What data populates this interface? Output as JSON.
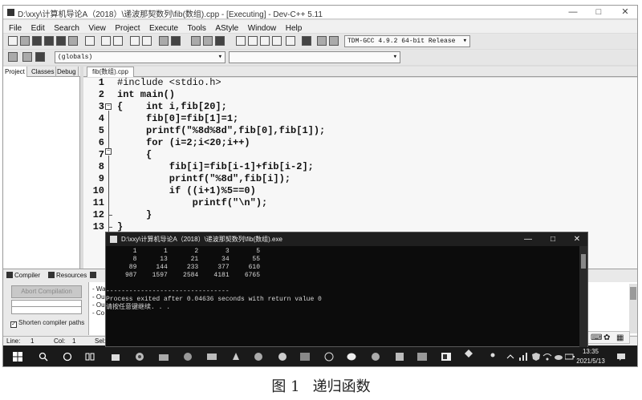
{
  "window": {
    "title": "D:\\xxy\\计算机导论A（2018）\\递波那契数列\\fib(数组).cpp - [Executing] - Dev-C++ 5.11",
    "controls": [
      "—",
      "□",
      "✕"
    ]
  },
  "menu": [
    "File",
    "Edit",
    "Search",
    "View",
    "Project",
    "Execute",
    "Tools",
    "AStyle",
    "Window",
    "Help"
  ],
  "toolbar": {
    "compiler_select": "TDM-GCC 4.9.2 64-bit Release",
    "scope_select": "(globals)"
  },
  "left_panel": {
    "tabs": [
      "Project",
      "Classes",
      "Debug"
    ]
  },
  "editor": {
    "tab": "fib(数组).cpp",
    "lines": [
      {
        "n": "1",
        "code": "#include <stdio.h>"
      },
      {
        "n": "2",
        "code": "int main()"
      },
      {
        "n": "3",
        "code": "{    int i,fib[20];"
      },
      {
        "n": "4",
        "code": "     fib[0]=fib[1]=1;"
      },
      {
        "n": "5",
        "code": "     printf(\"%8d%8d\",fib[0],fib[1]);"
      },
      {
        "n": "6",
        "code": "     for (i=2;i<20;i++)"
      },
      {
        "n": "7",
        "code": "     {"
      },
      {
        "n": "8",
        "code": "         fib[i]=fib[i-1]+fib[i-2];"
      },
      {
        "n": "9",
        "code": "         printf(\"%8d\",fib[i]);"
      },
      {
        "n": "10",
        "code": "         if ((i+1)%5==0)"
      },
      {
        "n": "11",
        "code": "             printf(\"\\n\");"
      },
      {
        "n": "12",
        "code": "     }"
      },
      {
        "n": "13",
        "code": "}"
      }
    ]
  },
  "bottom_panel": {
    "tabs": [
      "Compiler",
      "Resources"
    ],
    "abort_button": "Abort Compilation",
    "shorten_checkbox": "Shorten compiler paths",
    "messages": [
      "- Wa",
      "- Ou",
      "- Ou",
      "- Co"
    ]
  },
  "statusbar": {
    "line_label": "Line:",
    "line_value": "1",
    "col_label": "Col:",
    "col_value": "1",
    "sel_label": "Sel:"
  },
  "console": {
    "title": "D:\\xxy\\计算机导论A（2018）\\递波那契数列\\fib(数组).exe",
    "controls": [
      "—",
      "□",
      "✕"
    ],
    "output": [
      "       1       1       2       3       5",
      "       8      13      21      34      55",
      "      89     144     233     377     610",
      "     987    1597    2584    4181    6765",
      "",
      "--------------------------------",
      "Process exited after 0.04636 seconds with return value 0",
      "请按任意键继续. . ."
    ]
  },
  "taskbar": {
    "time": "13:35",
    "date": "2021/5/13",
    "ime": "中",
    "lang": "英"
  },
  "caption": {
    "fig": "图 1",
    "text": "递归函数"
  }
}
